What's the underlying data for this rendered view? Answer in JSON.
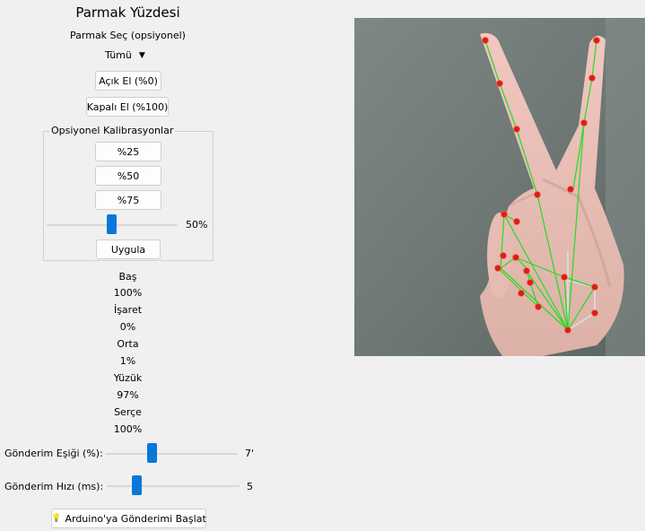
{
  "title": "Parmak Yüzdesi",
  "select_label": "Parmak Seç (opsiyonel)",
  "select_value": "Tümü",
  "buttons": {
    "open_hand": "Açık El (%0)",
    "closed_hand": "Kapalı El (%100)"
  },
  "calibration": {
    "group_title": "Opsiyonel Kalibrasyonlar",
    "b25": "%25",
    "b50": "%50",
    "b75": "%75",
    "slider_value_label": "50%",
    "slider_value": 50,
    "apply": "Uygula"
  },
  "fingers": [
    {
      "name": "Baş",
      "value": "100%"
    },
    {
      "name": "İşaret",
      "value": "0%"
    },
    {
      "name": "Orta",
      "value": "1%"
    },
    {
      "name": "Yüzük",
      "value": "97%"
    },
    {
      "name": "Serçe",
      "value": "100%"
    }
  ],
  "send_threshold": {
    "label": "Gönderim Eşiği (%):",
    "value_text": "7'"
  },
  "send_rate": {
    "label": "Gönderim Hızı (ms):",
    "value_text": "5"
  },
  "start_button": "Arduino'ya Gönderimi Başlat",
  "colors": {
    "accent": "#0a77d8",
    "landmark": "#d42020",
    "connector": "#22dd22"
  }
}
